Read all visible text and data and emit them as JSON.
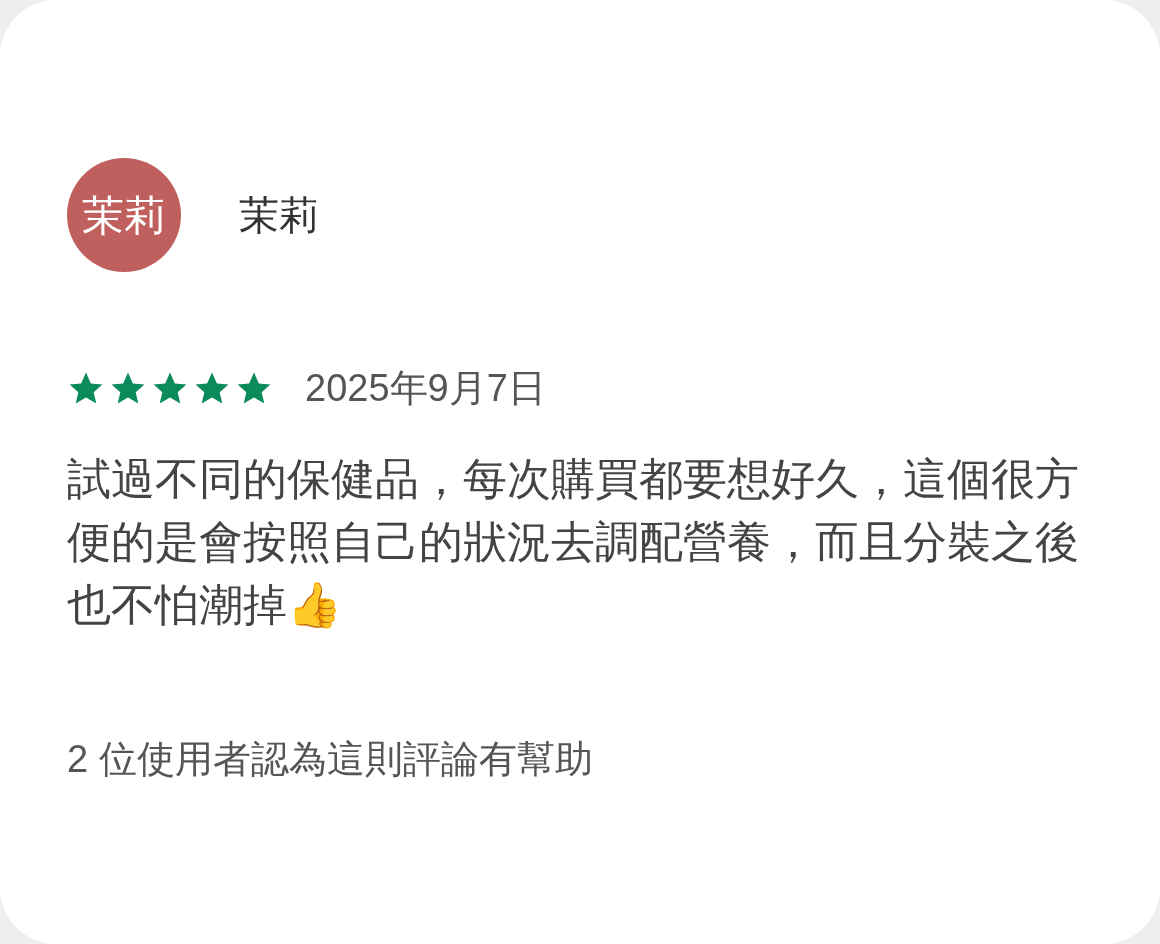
{
  "review": {
    "avatar": {
      "initials": "茉莉",
      "color": "#c0605e"
    },
    "author": "茉莉",
    "stars": 5,
    "date": "2025年9月7日",
    "body": "試過不同的保健品，每次購買都要想好久，這個很方便的是會按照自己的狀況去調配營養，而且分裝之後也不怕潮掉👍",
    "helpful": "2 位使用者認為這則評論有幫助"
  }
}
